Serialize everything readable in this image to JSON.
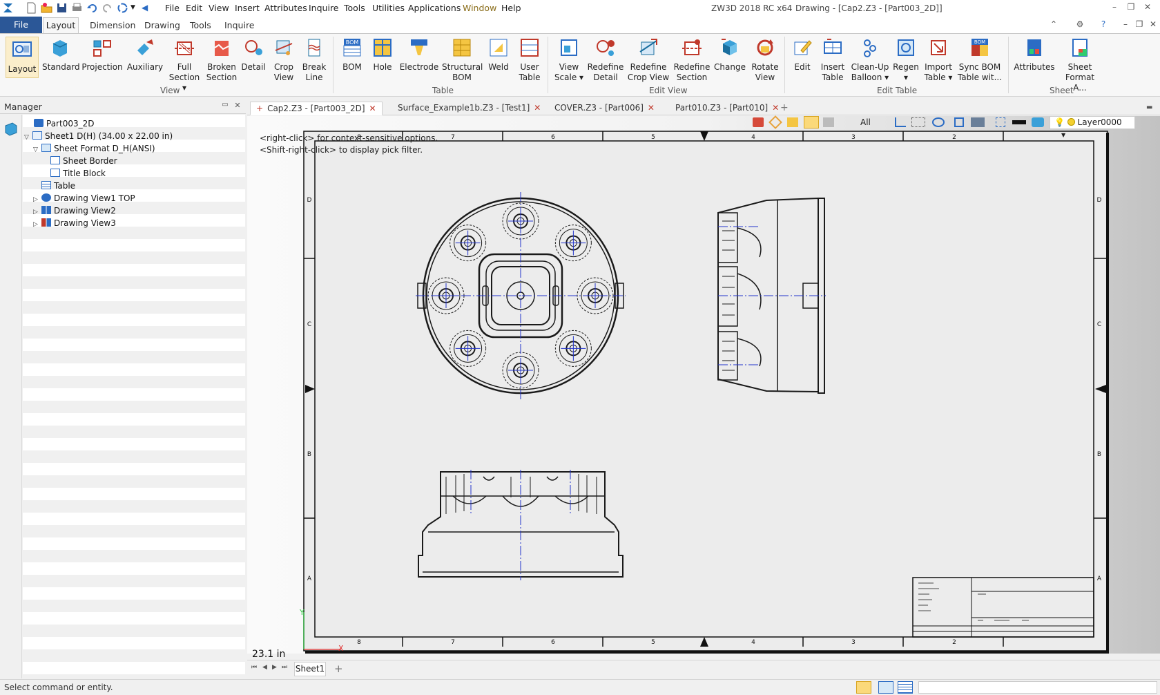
{
  "window": {
    "app_title": "ZW3D 2018 RC x64",
    "doc_title": "Drawing - [Cap2.Z3 - [Part003_2D]]"
  },
  "menu": [
    "File",
    "Edit",
    "View",
    "Insert",
    "Attributes",
    "Inquire",
    "Tools",
    "Utilities",
    "Applications",
    "Window",
    "Help"
  ],
  "ribbon_tabs": [
    "File",
    "Layout",
    "Dimension",
    "Drawing",
    "Tools",
    "Inquire"
  ],
  "ribbon_groups": {
    "view": {
      "label": "View",
      "buttons": [
        "Layout",
        "Standard",
        "Projection",
        "Auxiliary",
        "Full Section",
        "Broken Section",
        "Detail",
        "Crop View",
        "Break Line"
      ]
    },
    "table": {
      "label": "Table",
      "buttons": [
        "BOM",
        "Hole",
        "Electrode",
        "Structural BOM",
        "Weld",
        "User Table"
      ]
    },
    "edit_view": {
      "label": "Edit View",
      "buttons": [
        "View Scale",
        "Redefine Detail",
        "Redefine Crop View",
        "Redefine Section",
        "Change",
        "Rotate View"
      ]
    },
    "edit_table": {
      "label": "Edit Table",
      "buttons": [
        "Edit",
        "Insert Table",
        "Clean-Up Balloon",
        "Regen",
        "Import Table",
        "Sync BOM Table wit..."
      ]
    },
    "sheet": {
      "label": "Sheet",
      "buttons": [
        "Attributes",
        "Sheet Format A..."
      ]
    }
  },
  "manager": {
    "title": "Manager",
    "tree": [
      {
        "label": "Part003_2D"
      },
      {
        "label": "Sheet1 D(H) (34.00 x 22.00 in)"
      },
      {
        "label": "Sheet Format D_H(ANSI)"
      },
      {
        "label": "Sheet Border"
      },
      {
        "label": "Title Block"
      },
      {
        "label": "Table"
      },
      {
        "label": "Drawing View1 TOP"
      },
      {
        "label": "Drawing View2"
      },
      {
        "label": "Drawing View3"
      }
    ]
  },
  "doc_tabs": [
    {
      "label": "Cap2.Z3 - [Part003_2D]",
      "active": true
    },
    {
      "label": "Surface_Example1b.Z3 - [Test1]",
      "active": false
    },
    {
      "label": "COVER.Z3 - [Part006]",
      "active": false
    },
    {
      "label": "Part010.Z3 - [Part010]",
      "active": false
    }
  ],
  "drawing_toolbar": {
    "filter": "All",
    "layer": "Layer0000"
  },
  "viewport": {
    "hint_1": "<right-click> for context-sensitive options.",
    "hint_2": "<Shift-right-click> to display pick filter.",
    "scale_readout": "23.1 in",
    "sheet_zone_numbers": [
      "8",
      "7",
      "6",
      "5",
      "4",
      "3",
      "2"
    ],
    "sheet_zone_letters": [
      "D",
      "C",
      "B",
      "A"
    ],
    "axis_y": "Y",
    "axis_x": "X"
  },
  "sheet_tabs": [
    "Sheet1"
  ],
  "status": {
    "text": "Select command or entity."
  },
  "colors": {
    "file_tab": "#2b5797",
    "centerline": "#2233cc",
    "geometry": "#1a1a1a",
    "close_x": "#c0392b"
  }
}
